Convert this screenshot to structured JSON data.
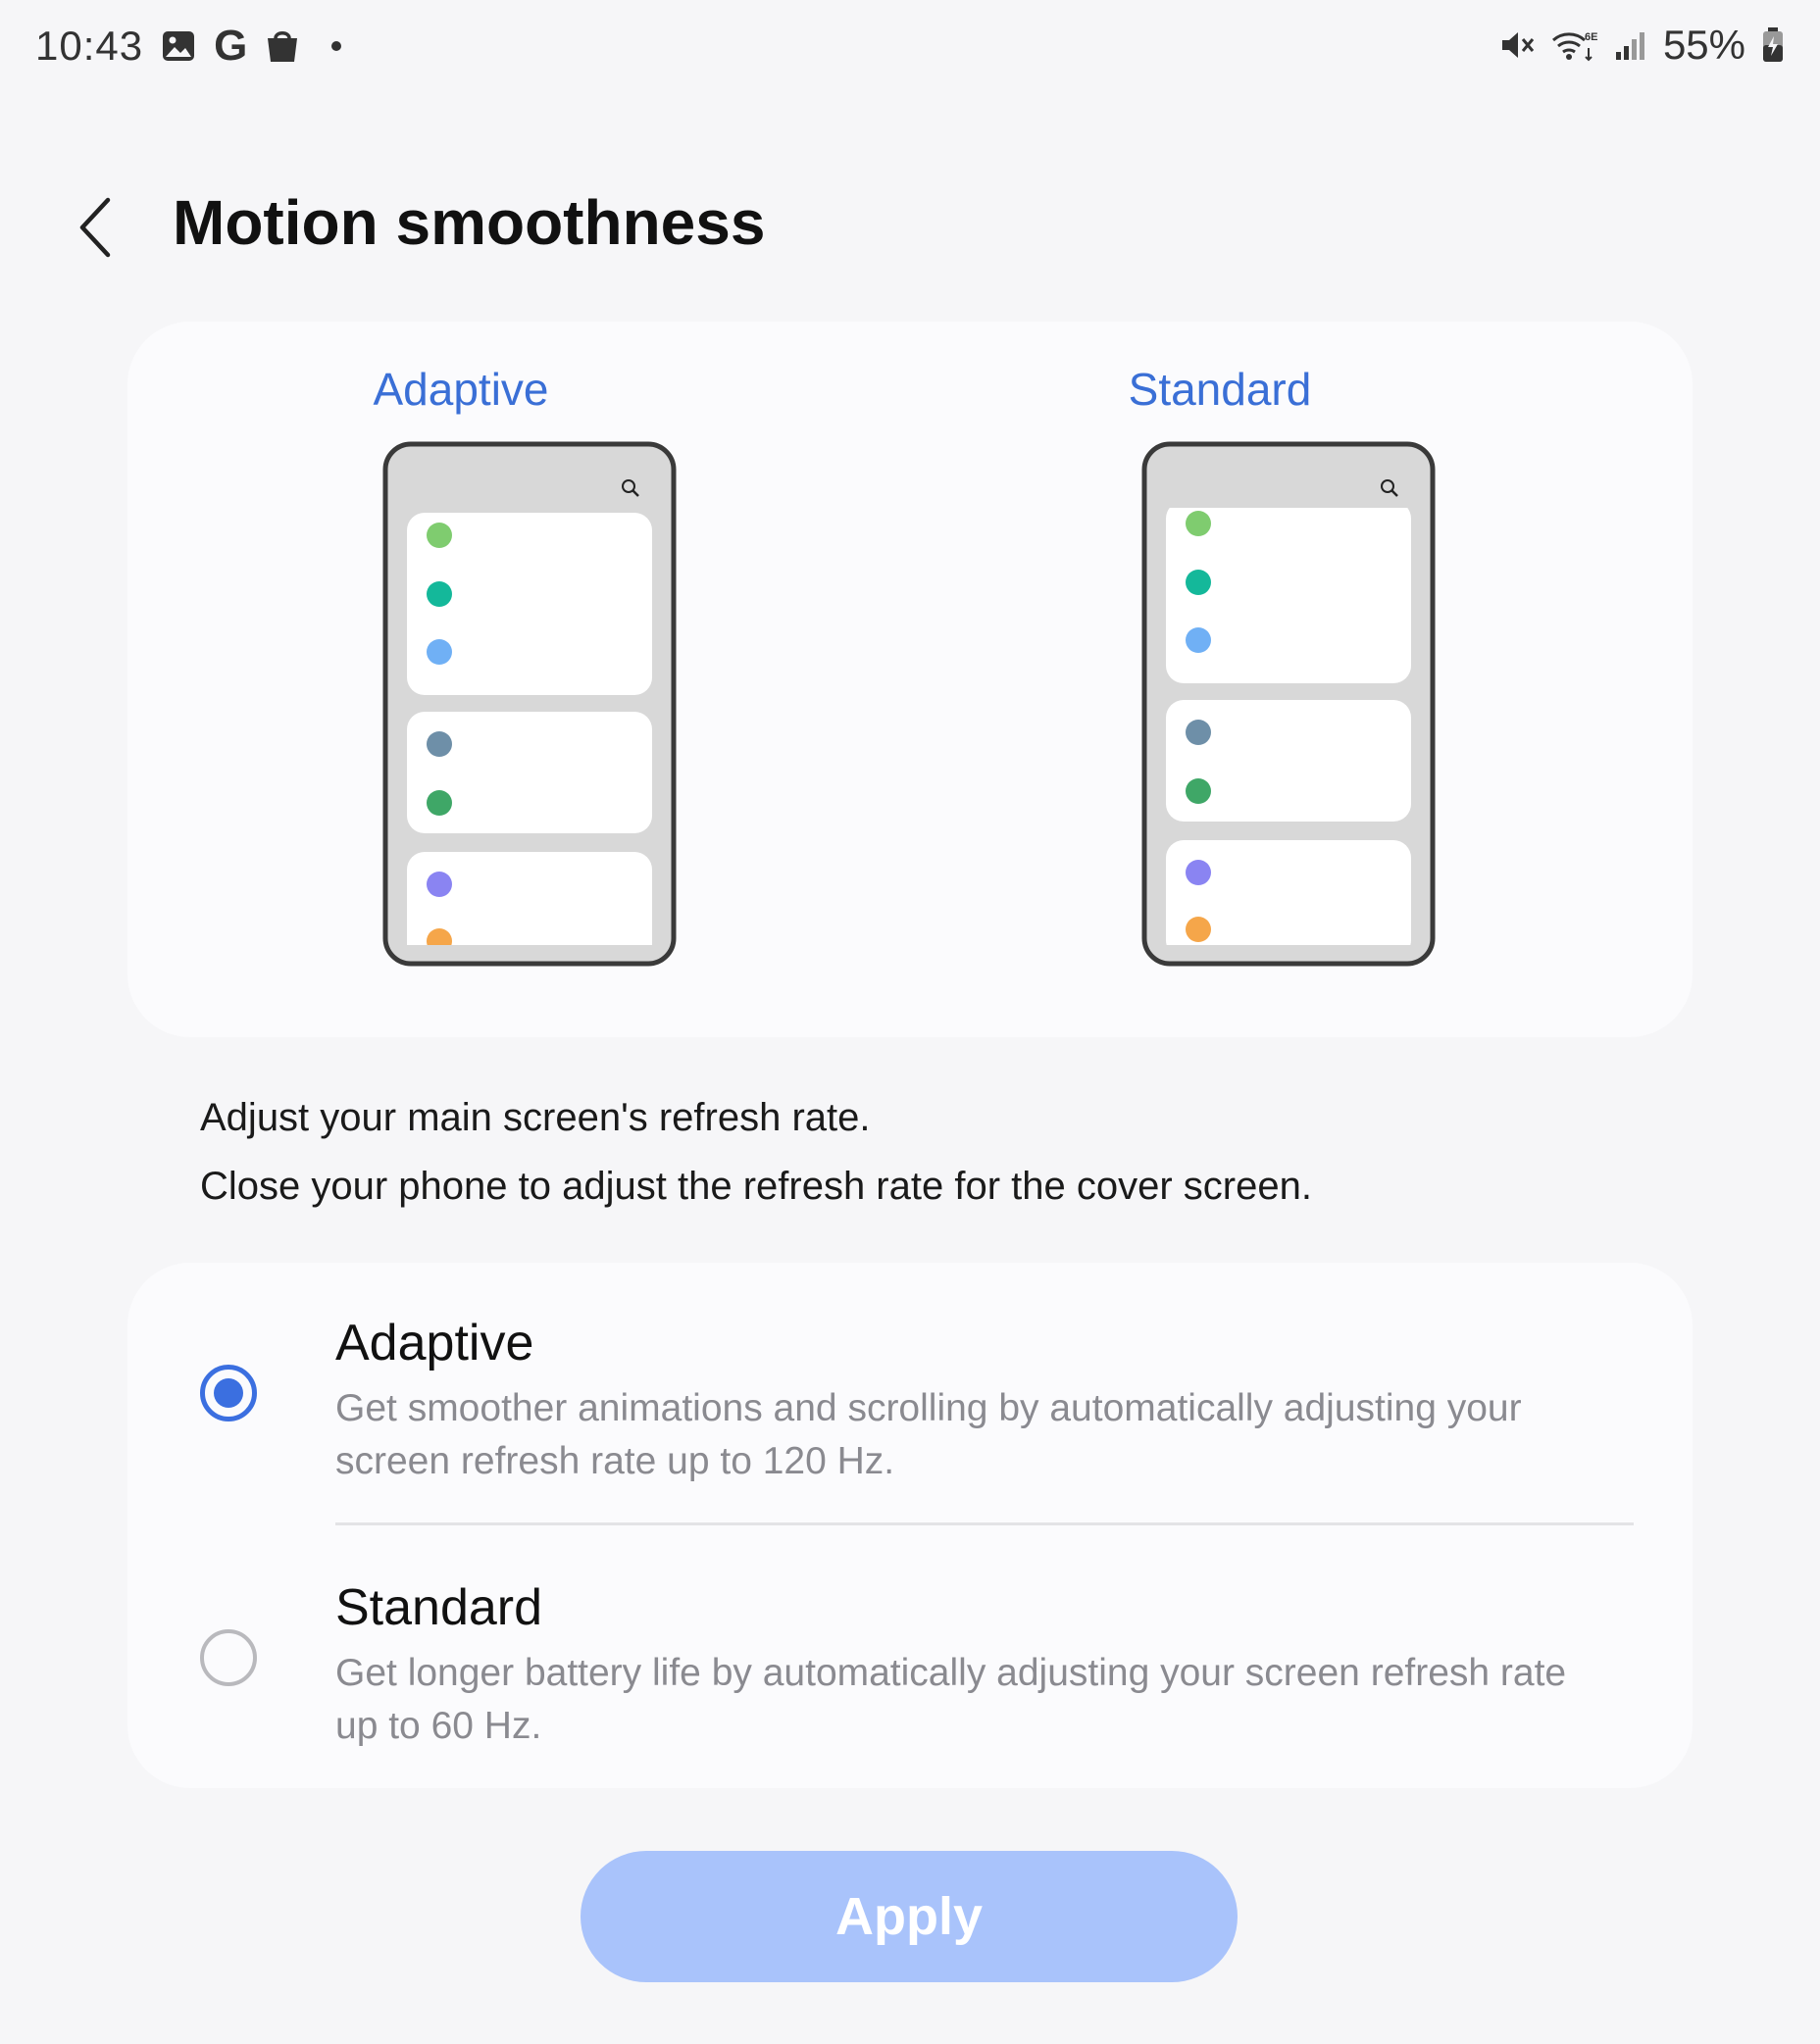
{
  "status_bar": {
    "time": "10:43",
    "battery": "55%",
    "left_icons": [
      "gallery-icon",
      "google-icon",
      "shopping-bag-icon",
      "notification-dot"
    ],
    "right_icons": [
      "mute-icon",
      "wifi-6e-icon",
      "signal-icon",
      "battery-charging-icon"
    ]
  },
  "header": {
    "title": "Motion smoothness"
  },
  "preview": {
    "adaptive_label": "Adaptive",
    "standard_label": "Standard",
    "dot_colors": [
      "#7fcc6f",
      "#14b89a",
      "#70b0f5",
      "#6e8fa8",
      "#3fa767",
      "#8a84f2",
      "#f5a64a"
    ]
  },
  "description": {
    "line1": "Adjust your main screen's refresh rate.",
    "line2": "Close your phone to adjust the refresh rate for the cover screen."
  },
  "options": [
    {
      "title": "Adaptive",
      "description": "Get smoother animations and scrolling by automatically adjusting your screen refresh rate up to 120 Hz.",
      "selected": true
    },
    {
      "title": "Standard",
      "description": "Get longer battery life by automatically adjusting your screen refresh rate up to 60 Hz.",
      "selected": false
    }
  ],
  "apply_button": {
    "label": "Apply",
    "enabled": false
  },
  "colors": {
    "accent": "#3b6fe0",
    "apply_disabled": "#a9c3fb",
    "preview_label": "#3a6fd6"
  }
}
